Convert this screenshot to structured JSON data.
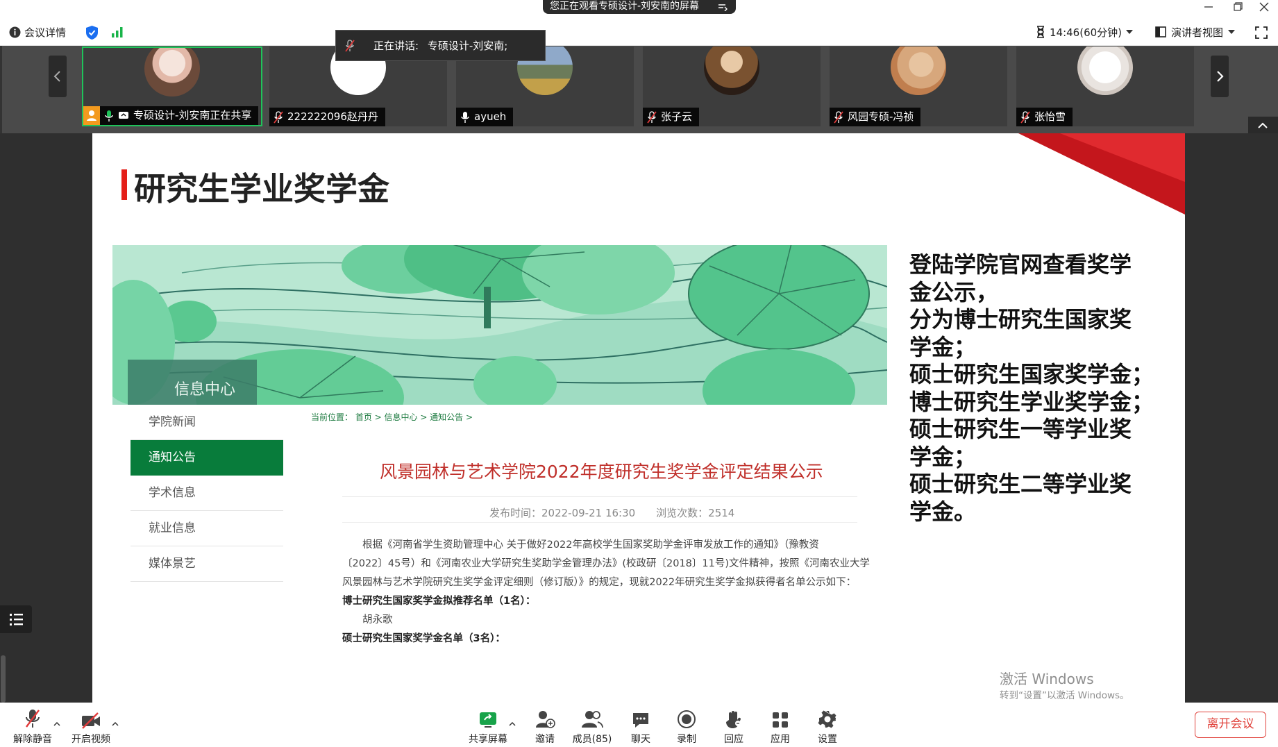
{
  "share_banner": "您正在观看专硕设计-刘安南的屏幕",
  "topbar": {
    "meeting_info": "会议详情",
    "timer": "14:46(60分钟)",
    "view_mode": "演讲者视图"
  },
  "speaking": {
    "label": "正在讲话:",
    "name": "专硕设计-刘安南;"
  },
  "participants": [
    {
      "name": "专硕设计-刘安南正在共享",
      "muted": false
    },
    {
      "name": "222222096赵丹丹",
      "muted": true
    },
    {
      "name": "ayueh",
      "muted": false
    },
    {
      "name": "张子云",
      "muted": true
    },
    {
      "name": "风园专硕-冯祯",
      "muted": true
    },
    {
      "name": "张怡雪",
      "muted": true
    }
  ],
  "slide": {
    "title": "研究生学业奖学金",
    "banner_label": "信息中心",
    "side_nav": [
      "学院新闻",
      "通知公告",
      "学术信息",
      "就业信息",
      "媒体景艺"
    ],
    "breadcrumb": "当前位置： 首页 > 信息中心 > 通知公告 >",
    "article_title": "风景园林与艺术学院2022年度研究生奖学金评定结果公示",
    "article_meta": "发布时间：2022-09-21 16:30　　浏览次数：2514",
    "paragraphs": [
      "　　根据《河南省学生资助管理中心 关于做好2022年高校学生国家奖助学金评审发放工作的通知》（豫教资",
      "〔2022〕45号）和《河南农业大学研究生奖助学金管理办法》(校政研〔2018〕11号)文件精神，按照《河南农业大学",
      "风景园林与艺术学院研究生奖学金评定细则（修订版）》的规定，现就2022年研究生奖学金拟获得者名单公示如下：",
      "博士研究生国家奖学金拟推荐名单（1名）：",
      "　　胡永歌",
      "硕士研究生国家奖学金名单（3名）："
    ],
    "right_text": [
      "登陆学院官网查看奖学",
      "金公示，",
      "分为博士研究生国家奖",
      "学金；",
      "硕士研究生国家奖学金；",
      "博士研究生学业奖学金；",
      "硕士研究生一等学业奖",
      "学金；",
      "硕士研究生二等学业奖",
      "学金。"
    ]
  },
  "watermark": {
    "line1": "激活 Windows",
    "line2": "转到“设置”以激活 Windows。"
  },
  "bottombar": {
    "unmute": "解除静音",
    "start_video": "开启视频",
    "share_screen": "共享屏幕",
    "invite": "邀请",
    "members": "成员(85)",
    "chat": "聊天",
    "record": "录制",
    "react": "回应",
    "apps": "应用",
    "settings": "设置",
    "leave": "离开会议"
  },
  "colors": {
    "accent_green": "#087c3b",
    "title_red": "#e41f19",
    "leave_red": "#e0413a",
    "active_speaker_border": "#1fc35a"
  }
}
